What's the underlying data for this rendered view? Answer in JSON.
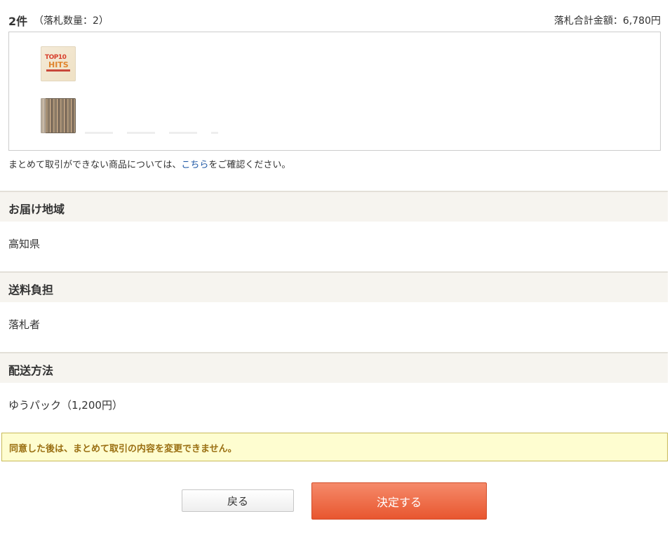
{
  "summary": {
    "count": "2件",
    "quantity": "（落札数量：2）",
    "total": "落札合計金額：6,780円"
  },
  "items": [
    {
      "thumb_text_top": "TOP10",
      "thumb_text_main": "HITS"
    },
    {
      "thumb_text_top": "",
      "thumb_text_main": ""
    }
  ],
  "note": {
    "before": "まとめて取引ができない商品については、",
    "link": "こちら",
    "after": "をご確認ください。"
  },
  "sections": {
    "region": {
      "title": "お届け地域",
      "value": "高知県"
    },
    "shipping_cost": {
      "title": "送料負担",
      "value": "落札者"
    },
    "shipping_method": {
      "title": "配送方法",
      "value": "ゆうパック（1,200円）"
    }
  },
  "warning": "同意した後は、まとめて取引の内容を変更できません。",
  "buttons": {
    "back": "戻る",
    "submit": "決定する"
  },
  "colors": {
    "link": "#1f58a5",
    "warning_bg": "#fefdd0",
    "warning_text": "#9a6f12",
    "submit_bg": "#e8562f",
    "section_bg": "#f6f4ef"
  }
}
